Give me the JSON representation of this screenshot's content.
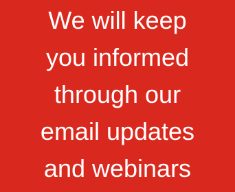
{
  "banner": {
    "background_color": "#d9291e",
    "text_color": "#ffffff",
    "lines": [
      "We will keep",
      "you informed",
      "through our",
      "email updates",
      "and webinars"
    ]
  }
}
